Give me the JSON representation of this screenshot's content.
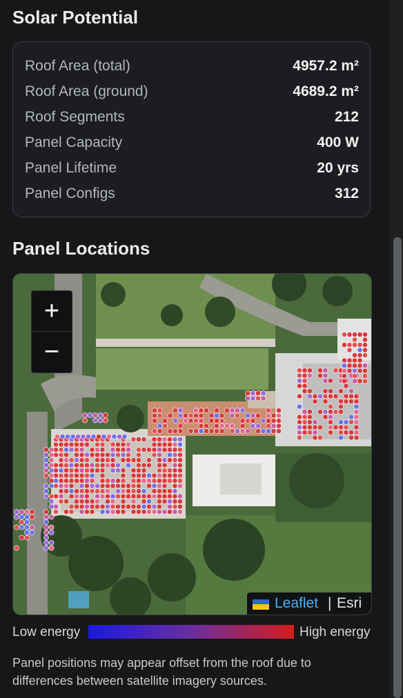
{
  "solar": {
    "title": "Solar Potential",
    "stats": [
      {
        "label": "Roof Area (total)",
        "value": "4957.2 m²"
      },
      {
        "label": "Roof Area (ground)",
        "value": "4689.2 m²"
      },
      {
        "label": "Roof Segments",
        "value": "212"
      },
      {
        "label": "Panel Capacity",
        "value": "400 W"
      },
      {
        "label": "Panel Lifetime",
        "value": "20 yrs"
      },
      {
        "label": "Panel Configs",
        "value": "312"
      }
    ]
  },
  "panels": {
    "title": "Panel Locations",
    "zoom_in": "+",
    "zoom_out": "−",
    "attribution": {
      "leaflet": "Leaflet",
      "separator": "|",
      "esri": "Esri"
    },
    "legend": {
      "low": "Low energy",
      "high": "High energy"
    },
    "note": "Panel positions may appear offset from the roof due to differences between satellite imagery sources.",
    "colors": {
      "low": "#1b19e0",
      "mid": "#6a2fa0",
      "high": "#d21d1d"
    }
  }
}
